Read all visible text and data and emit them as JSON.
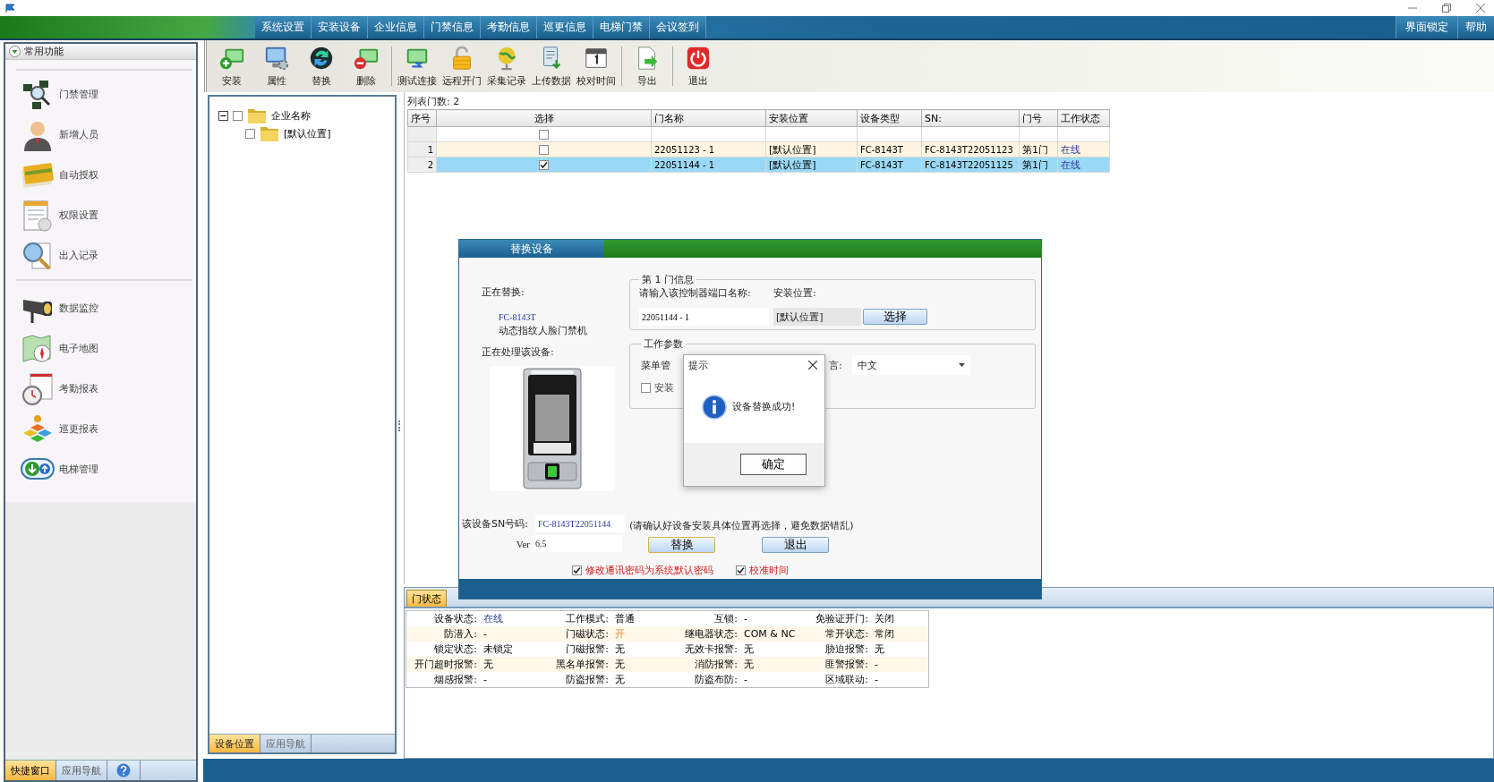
{
  "menu": {
    "items": [
      "系统设置",
      "安装设备",
      "企业信息",
      "门禁信息",
      "考勤信息",
      "巡更信息",
      "电梯门禁",
      "会议签到"
    ],
    "right_items": [
      "界面锁定",
      "帮助"
    ]
  },
  "sidebar": {
    "title": "常用功能",
    "groups": [
      [
        {
          "label": "门禁管理",
          "kind": "chips"
        },
        {
          "label": "新增人员",
          "kind": "person"
        },
        {
          "label": "自动授权",
          "kind": "card"
        },
        {
          "label": "权限设置",
          "kind": "document"
        },
        {
          "label": "出入记录",
          "kind": "search"
        }
      ],
      [
        {
          "label": "数据监控",
          "kind": "camera"
        },
        {
          "label": "电子地图",
          "kind": "map"
        },
        {
          "label": "考勤报表",
          "kind": "clock"
        },
        {
          "label": "巡更报表",
          "kind": "blocks"
        },
        {
          "label": "电梯管理",
          "kind": "elevator"
        }
      ]
    ],
    "tabs": [
      {
        "label": "快捷窗口",
        "selected": true
      },
      {
        "label": "应用导航",
        "selected": false
      }
    ]
  },
  "toolbar": [
    [
      {
        "label": "安装",
        "kind": "install"
      },
      {
        "label": "属性",
        "kind": "properties"
      },
      {
        "label": "替换",
        "kind": "replace"
      },
      {
        "label": "删除",
        "kind": "delete"
      }
    ],
    [
      {
        "label": "测试连接",
        "kind": "test"
      },
      {
        "label": "远程开门",
        "kind": "unlock"
      },
      {
        "label": "采集记录",
        "kind": "collect"
      },
      {
        "label": "上传数据",
        "kind": "upload"
      },
      {
        "label": "校对时间",
        "kind": "calendar"
      }
    ],
    [
      {
        "label": "导出",
        "kind": "export"
      }
    ],
    [
      {
        "label": "退出",
        "kind": "exit"
      }
    ]
  ],
  "tree": {
    "nodes": [
      {
        "label": "企业名称",
        "expanded": true,
        "checked": false,
        "children": [
          {
            "label": "[默认位置]",
            "checked": false
          }
        ]
      }
    ],
    "tabs": [
      {
        "label": "设备位置",
        "selected": true
      },
      {
        "label": "应用导航",
        "selected": false
      }
    ]
  },
  "list_count": "列表门数: 2",
  "table": {
    "columns": [
      "序号",
      "选择",
      "门名称",
      "安装位置",
      "设备类型",
      "SN:",
      "门号",
      "工作状态"
    ],
    "filter_row": {
      "checked": false
    },
    "rows": [
      {
        "checked": false,
        "selected": false,
        "cells": [
          "1",
          "",
          "22051123 - 1",
          "[默认位置]",
          "FC-8143T",
          "FC-8143T22051123",
          "第1门",
          "在线"
        ]
      },
      {
        "checked": true,
        "selected": true,
        "cells": [
          "2",
          "",
          "22051144 - 1",
          "[默认位置]",
          "FC-8143T",
          "FC-8143T22051125",
          "第1门",
          "在线"
        ]
      }
    ]
  },
  "status_panel": {
    "tabs": [
      {
        "label": "门状态",
        "selected": true
      }
    ],
    "rows": [
      [
        {
          "label": "设备状态:",
          "value": "在线",
          "kind": "online"
        },
        {
          "label": "工作模式:",
          "value": "普通",
          "kind": "normal"
        },
        {
          "label": "互锁:",
          "value": "-",
          "kind": "normal"
        },
        {
          "label": "免验证开门:",
          "value": "关闭",
          "kind": "normal"
        }
      ],
      [
        {
          "label": "防潜入:",
          "value": "-",
          "kind": "normal"
        },
        {
          "label": "门磁状态:",
          "value": "开",
          "kind": "warning"
        },
        {
          "label": "继电器状态:",
          "value": "COM & NC",
          "kind": "normal"
        },
        {
          "label": "常开状态:",
          "value": "常闭",
          "kind": "normal"
        }
      ],
      [
        {
          "label": "锁定状态:",
          "value": "未锁定",
          "kind": "normal"
        },
        {
          "label": "门磁报警:",
          "value": "无",
          "kind": "normal"
        },
        {
          "label": "无效卡报警:",
          "value": "无",
          "kind": "normal"
        },
        {
          "label": "胁迫报警:",
          "value": "无",
          "kind": "normal"
        }
      ],
      [
        {
          "label": "开门超时报警:",
          "value": "无",
          "kind": "normal"
        },
        {
          "label": "黑名单报警:",
          "value": "无",
          "kind": "normal"
        },
        {
          "label": "消防报警:",
          "value": "无",
          "kind": "normal"
        },
        {
          "label": "匪警报警:",
          "value": "-",
          "kind": "normal"
        }
      ],
      [
        {
          "label": "烟感报警:",
          "value": "-",
          "kind": "normal"
        },
        {
          "label": "防盗报警:",
          "value": "无",
          "kind": "normal"
        },
        {
          "label": "防盗布防:",
          "value": "-",
          "kind": "normal"
        },
        {
          "label": "区域联动:",
          "value": "-",
          "kind": "normal"
        }
      ]
    ]
  },
  "dialog": {
    "title": "替换设备",
    "replacing_label": "正在替换:",
    "model": "FC-8143T",
    "description": "动态指纹人脸门禁机",
    "processing_label": "正在处理该设备:",
    "sn_label": "该设备SN号码:",
    "sn_value": "FC-8143T22051144",
    "version_label": "Ver",
    "version_value": "6.5",
    "door_group": {
      "title": "第 1 门信息",
      "name_label": "请输入该控制器端口名称:",
      "name_value": "22051144 - 1",
      "location_label": "安装位置:",
      "location_value": "[默认位置]",
      "select_button": "选择"
    },
    "params_group": {
      "title": "工作参数",
      "menu_label": "菜单管",
      "language_label": "言:",
      "language_value": "中文",
      "install_option": {
        "label": "安装",
        "checked": false
      }
    },
    "note": "(请确认好设备安装具体位置再选择，避免数据错乱)",
    "buttons": [
      "替换",
      "退出"
    ],
    "options": [
      {
        "label": "修改通讯密码为系统默认密码",
        "checked": true
      },
      {
        "label": "校准时间",
        "checked": true
      }
    ]
  },
  "message_box": {
    "title": "提示",
    "text": "设备替换成功!",
    "button": "确定"
  }
}
